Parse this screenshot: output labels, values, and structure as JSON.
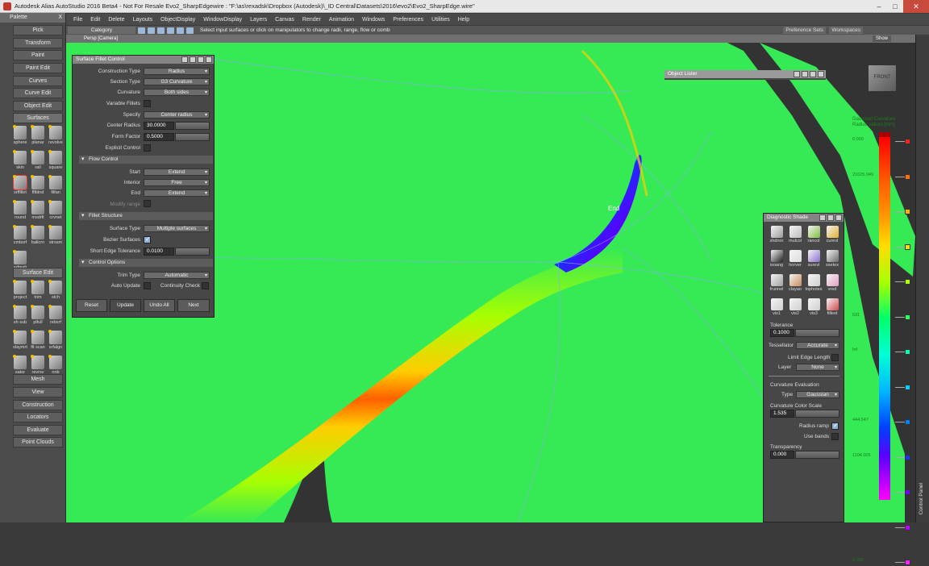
{
  "title_bar": {
    "text": "Autodesk Alias AutoStudio 2016 Beta4 - Not For Resale   Evo2_SharpEdgewire : \"F:\\as\\rexadsk\\Dropbox (Autodesk)\\_ID Central\\Datasets\\2016\\evo2\\Evo2_SharpEdge.wire\"",
    "minimize": "–",
    "maximize": "□",
    "close": "✕"
  },
  "menu": [
    "File",
    "Edit",
    "Delete",
    "Layouts",
    "ObjectDisplay",
    "WindowDisplay",
    "Layers",
    "Canvas",
    "Render",
    "Animation",
    "Windows",
    "Preferences",
    "Utilities",
    "Help"
  ],
  "palette": {
    "title": "Palette",
    "close": "X",
    "buttons": [
      "Pick",
      "Transform",
      "Paint",
      "Paint Edit",
      "Curves",
      "Curve Edit",
      "Object Edit",
      "Surfaces"
    ],
    "surfaces_tools": [
      "sphere",
      "planar",
      "revolve",
      "skin",
      "rail",
      "square",
      "srffillet",
      "fflblnd",
      "filfan",
      "round",
      "msdrft",
      "crvnet",
      "cmbsrf",
      "ballcrn",
      "strssm",
      "srfmsh"
    ],
    "surface_edit_label": "Surface Edit",
    "surface_edit_tools": [
      "project",
      "trim",
      "stch",
      "sh sub",
      "plfull",
      "rebsrf",
      "slaymrt",
      "flt scan",
      "srfalgn",
      "sator",
      "revrsv",
      "nnb"
    ],
    "bottom_buttons": [
      "Mesh",
      "View",
      "Construction",
      "Locators",
      "Evaluate",
      "Point Clouds"
    ]
  },
  "options_bar": {
    "category": "Category",
    "hint": "Select input surfaces or click on manipulators to change radii, range, flow or comb",
    "preference_sets": "Preference Sets",
    "workspaces": "Workspaces"
  },
  "viewport": {
    "label": "Persp [Camera]",
    "show": "Show",
    "end_label": "End",
    "cube_label": "FRONT"
  },
  "fillet": {
    "title": "Surface Fillet Control",
    "construction_type_label": "Construction Type",
    "construction_type": "Radius",
    "section_type_label": "Section Type",
    "section_type": "G3 Curvature",
    "curvature_label": "Curvature",
    "curvature": "Both sides",
    "variable_fillets": "Variable Fillets",
    "specify_label": "Specify",
    "specify": "Center radius",
    "center_radius_label": "Center Radius",
    "center_radius": "30.0000",
    "form_factor_label": "Form Factor",
    "form_factor": "0.5000",
    "explicit_control": "Explicit Control",
    "flow_section": "Flow Control",
    "start_label": "Start",
    "start": "Extend",
    "interior_label": "Interior",
    "interior": "Free",
    "end_label": "End",
    "end": "Extend",
    "modify_range": "Modify range",
    "structure_section": "Fillet Structure",
    "surface_type_label": "Surface Type",
    "surface_type": "Multiple surfaces",
    "bezier_label": "Bezier Surfaces",
    "short_edge_label": "Short Edge Tolerance",
    "short_edge": "0.0100",
    "control_section": "Control Options",
    "trim_type_label": "Trim Type",
    "trim_type": "Automatic",
    "auto_update": "Auto Update",
    "continuity_check": "Continuity Check",
    "reset": "Reset",
    "update": "Update",
    "undo_all": "Undo All",
    "next": "Next"
  },
  "object_lister": {
    "title": "Object Lister"
  },
  "diagnostic": {
    "title": "Diagnostic Shade",
    "icons": [
      {
        "label": "shdron",
        "color": "#9a9a9a"
      },
      {
        "label": "mulcol",
        "color": "#bdbdbd"
      },
      {
        "label": "rancol",
        "color": "#7fbf3f"
      },
      {
        "label": "curevl",
        "color": "#e0b030"
      },
      {
        "label": "isoang",
        "color": "#222222"
      },
      {
        "label": "horver",
        "color": "#dddddd"
      },
      {
        "label": "surevl",
        "color": "#8a6fd0"
      },
      {
        "label": "ssetex",
        "color": "#6a6a6a"
      },
      {
        "label": "frunnel",
        "color": "#a0a0a0"
      },
      {
        "label": "clayao",
        "color": "#c98a5a"
      },
      {
        "label": "tophotes",
        "color": "#cfcfcf"
      },
      {
        "label": "vred",
        "color": "#e0a0c0"
      },
      {
        "label": "vis1",
        "color": "#cfcfcf"
      },
      {
        "label": "vis2",
        "color": "#cfcfcf"
      },
      {
        "label": "vis3",
        "color": "#cfcfcf"
      },
      {
        "label": "fillest",
        "color": "#d24a4a"
      }
    ],
    "tolerance_label": "Tolerance",
    "tolerance": "0.1000",
    "tessellator_label": "Tessellator",
    "tessellator": "Accurate",
    "limit_edge": "Limit Edge Length",
    "layer_label": "Layer",
    "layer": "None",
    "curv_eval": "Curvature Evaluation",
    "type_label": "Type",
    "type": "Gaussian",
    "color_scale_label": "Curvature Color Scale",
    "color_scale": "1.535",
    "radius_ramp": "Radius ramp",
    "use_bands": "Use bands",
    "transparency_label": "Transparency",
    "transparency": "0.000"
  },
  "ramp": {
    "title": "Gaussian Curvature",
    "subtitle": "Radius values [mm]",
    "values": [
      "0.000",
      "21625.049",
      "",
      "",
      "",
      "531",
      "Inf",
      "",
      "444.547",
      "1104.005",
      "",
      "",
      "6.002"
    ]
  },
  "control_panel": "Control Panel"
}
